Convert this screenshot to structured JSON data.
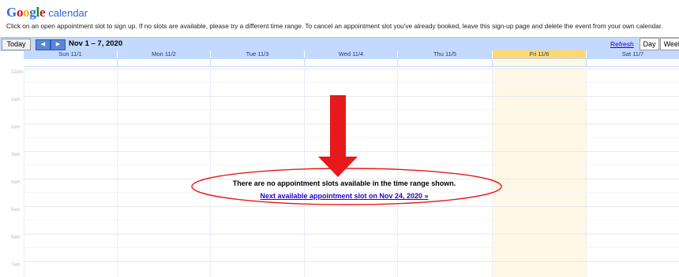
{
  "header": {
    "logo_text": "Google",
    "product": "calendar",
    "instructions": "Click on an open appointment slot to sign up. If no slots are available, please try a different time range. To cancel an appointment slot you've already booked, leave this sign-up page and delete the event from your own calendar."
  },
  "toolbar": {
    "today_label": "Today",
    "prev_icon": "◀",
    "next_icon": "▶",
    "date_range": "Nov 1 – 7, 2020",
    "refresh_label": "Refresh",
    "views": [
      "Day",
      "Week"
    ]
  },
  "days": [
    "Sun 11/1",
    "Mon 11/2",
    "Tue 11/3",
    "Wed 11/4",
    "Thu 11/5",
    "Fri 11/6",
    "Sat 11/7"
  ],
  "hours": [
    "12am",
    "1am",
    "2am",
    "3am",
    "4am",
    "5am",
    "6am",
    "7am"
  ],
  "message": {
    "text": "There are no appointment slots available in the time range shown.",
    "link": "Next available appointment slot on Nov 24, 2020 »"
  },
  "colors": {
    "toolbar_bg": "#c3d9ff",
    "today_highlight": "#ffd86b",
    "annotation_red": "#e8191c",
    "link": "#2200cc"
  }
}
